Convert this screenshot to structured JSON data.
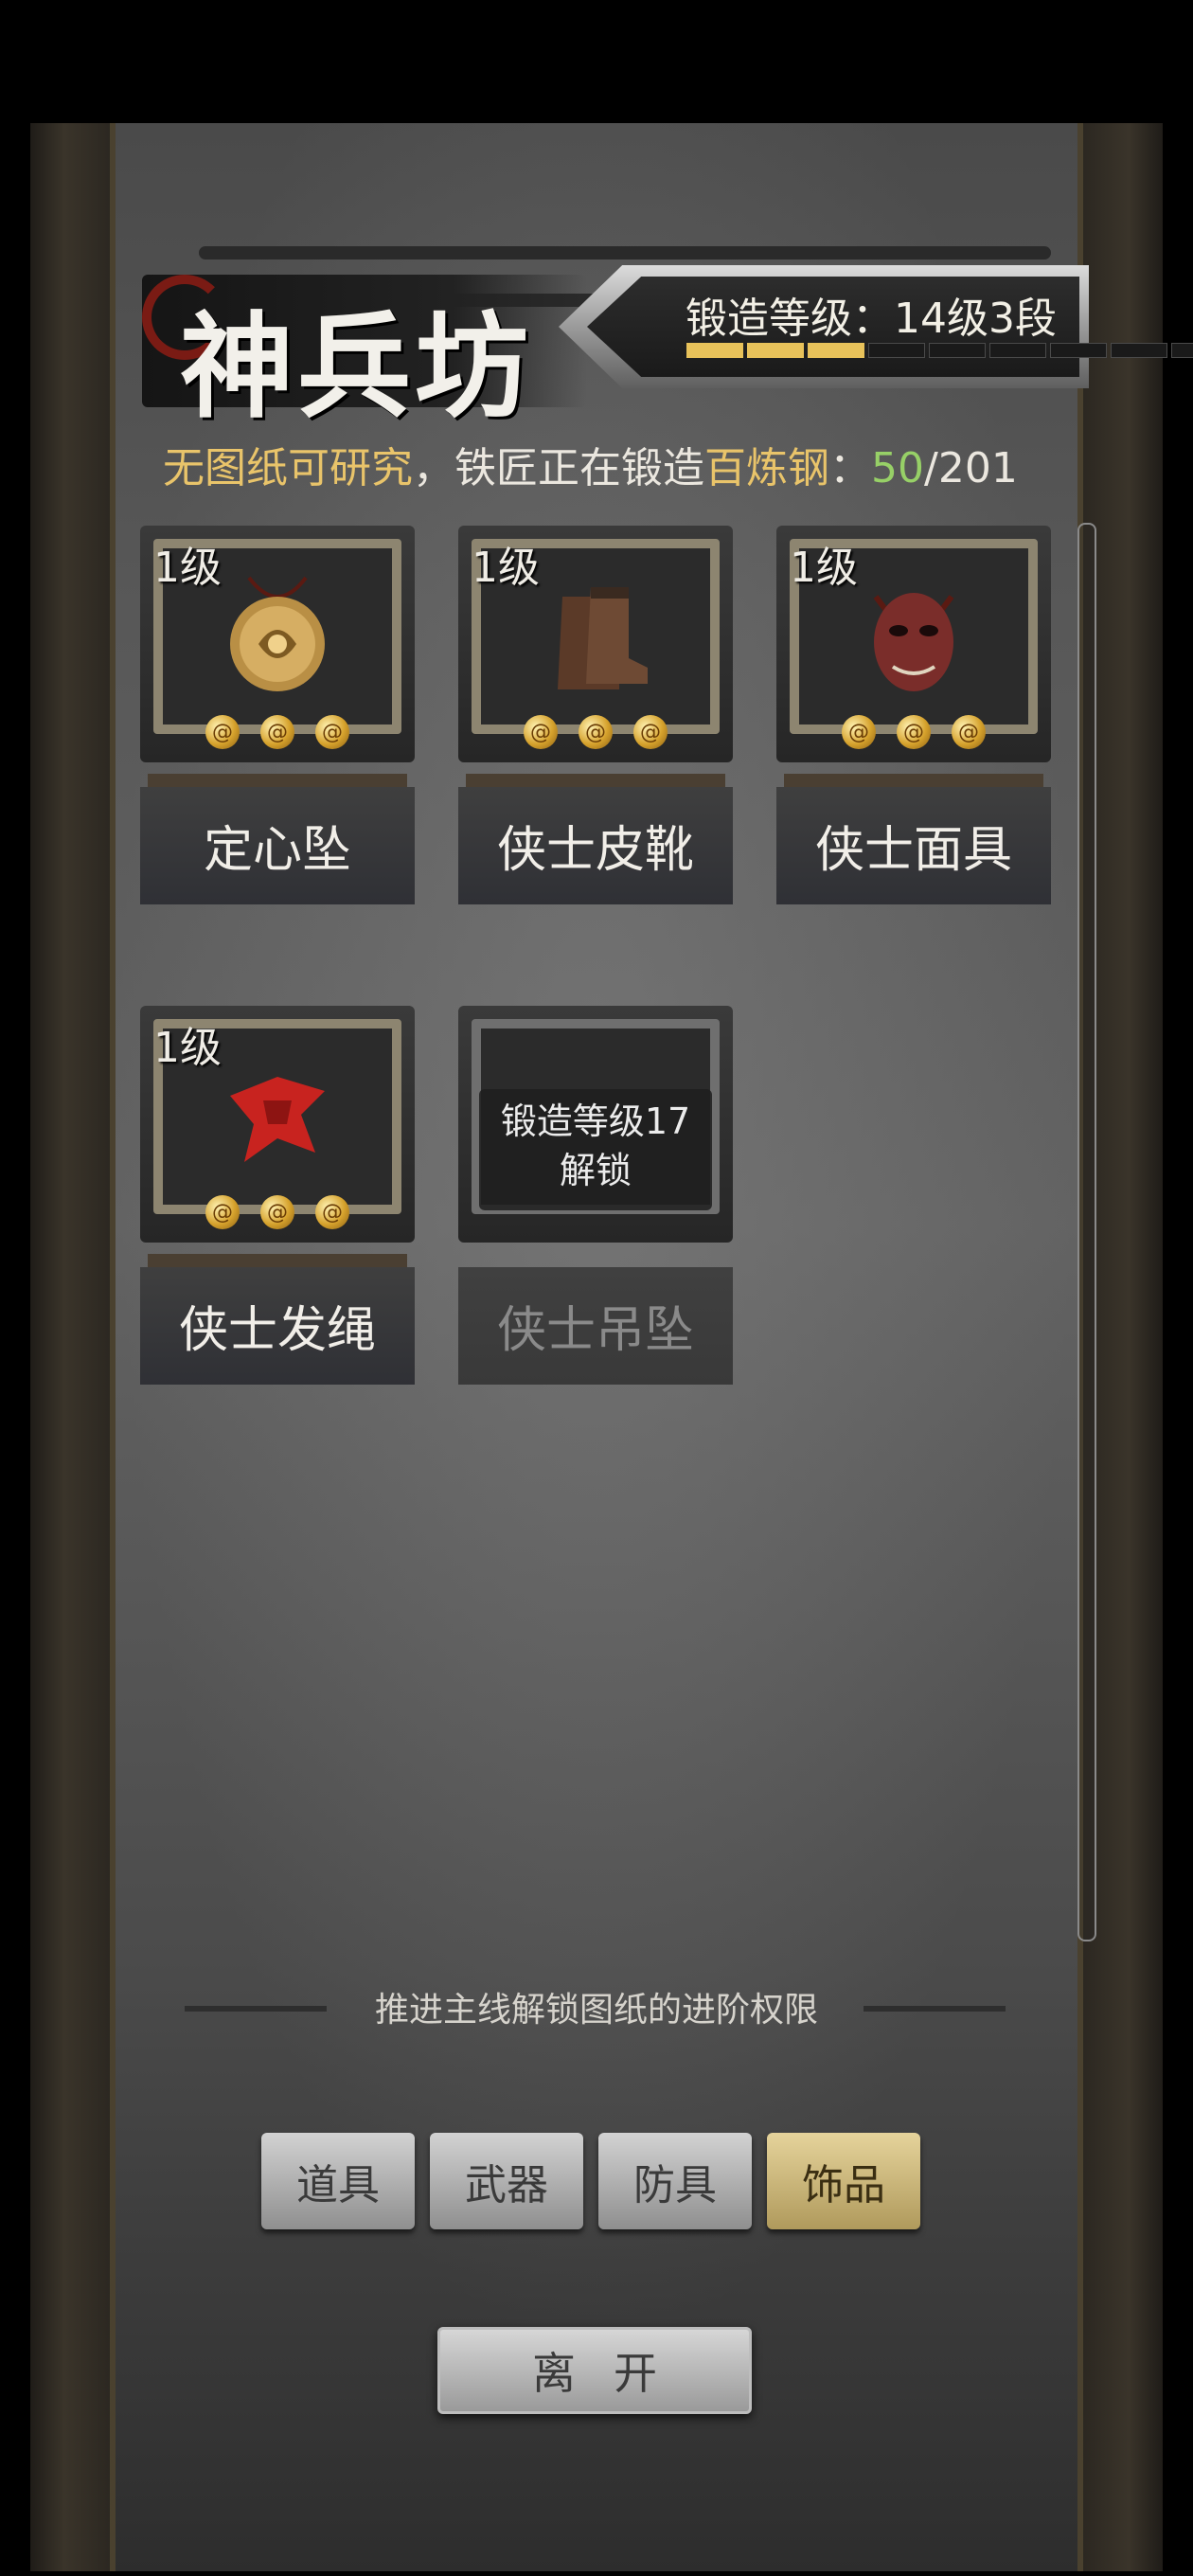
{
  "header": {
    "title": "神兵坊",
    "forge_level": "锻造等级：14级3段",
    "forge_progress_segments_filled": 3,
    "forge_progress_segments_total": 10
  },
  "status": {
    "no_blueprint": "无图纸可研究",
    "middle": "，铁匠正在锻造",
    "material": "百炼钢",
    "colon": "：",
    "current": "50",
    "total": "/201"
  },
  "items": [
    {
      "level": "1级",
      "name": "定心坠",
      "icon": "pendant-icon",
      "stars": 3
    },
    {
      "level": "1级",
      "name": "侠士皮靴",
      "icon": "boots-icon",
      "stars": 3
    },
    {
      "level": "1级",
      "name": "侠士面具",
      "icon": "mask-icon",
      "stars": 3
    },
    {
      "level": "1级",
      "name": "侠士发绳",
      "icon": "hair-ribbon-icon",
      "stars": 3
    },
    {
      "name": "侠士吊坠",
      "locked": true,
      "lock_line1": "锻造等级17",
      "lock_line2": "解锁"
    }
  ],
  "hint": "推进主线解锁图纸的进阶权限",
  "tabs": [
    {
      "label": "道具",
      "active": false
    },
    {
      "label": "武器",
      "active": false
    },
    {
      "label": "防具",
      "active": false
    },
    {
      "label": "饰品",
      "active": true
    }
  ],
  "leave_label": "离开",
  "colors": {
    "gold": "#e9c46a",
    "green": "#97d067",
    "progress": "#e8c25a",
    "active_tab": "#d8c47f"
  }
}
